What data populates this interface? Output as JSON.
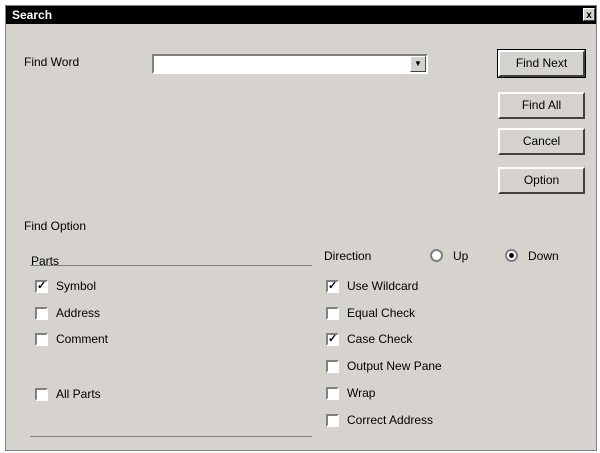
{
  "window": {
    "title": "Search",
    "close_glyph": "x"
  },
  "find_word": {
    "label": "Find Word",
    "value": "",
    "dropdown_glyph": "▼"
  },
  "buttons": {
    "find_next": "Find Next",
    "find_all": "Find All",
    "cancel": "Cancel",
    "option": "Option"
  },
  "find_option": {
    "label": "Find Option"
  },
  "parts": {
    "label": "Parts",
    "items": [
      {
        "label": "Symbol",
        "checked": true
      },
      {
        "label": "Address",
        "checked": false
      },
      {
        "label": "Comment",
        "checked": false
      },
      {
        "label": "All Parts",
        "checked": false
      }
    ]
  },
  "direction": {
    "label": "Direction",
    "options": [
      {
        "label": "Up",
        "selected": false
      },
      {
        "label": "Down",
        "selected": true
      }
    ]
  },
  "options": [
    {
      "label": "Use Wildcard",
      "checked": true
    },
    {
      "label": "Equal Check",
      "checked": false
    },
    {
      "label": "Case Check",
      "checked": true
    },
    {
      "label": "Output New Pane",
      "checked": false
    },
    {
      "label": "Wrap",
      "checked": false
    },
    {
      "label": "Correct Address",
      "checked": false
    }
  ],
  "check_glyph": "✓"
}
